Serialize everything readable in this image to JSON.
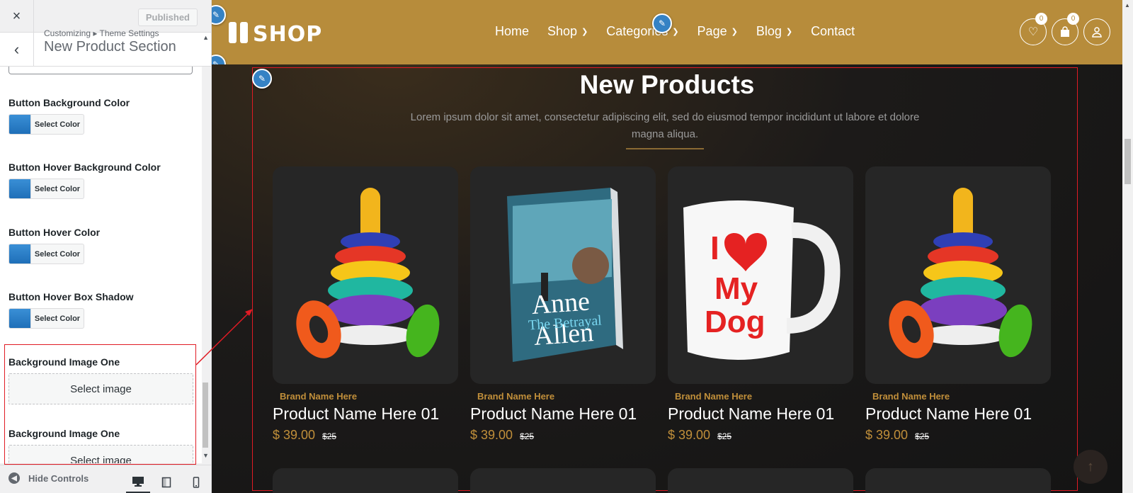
{
  "customizer": {
    "close_icon": "×",
    "publish_label": "Published",
    "breadcrumb": "Customizing ▸ Theme Settings",
    "section_title": "New Product Section",
    "controls": [
      {
        "label": "Button Background Color",
        "button": "Select Color"
      },
      {
        "label": "Button Hover Background Color",
        "button": "Select Color"
      },
      {
        "label": "Button Hover Color",
        "button": "Select Color"
      },
      {
        "label": "Button Hover Box Shadow",
        "button": "Select Color"
      }
    ],
    "image_controls": [
      {
        "label": "Background Image One",
        "button": "Select image"
      },
      {
        "label": "Background Image One",
        "button": "Select image"
      }
    ],
    "hide_controls": "Hide Controls",
    "swatch_color": "#2b7fcb"
  },
  "site": {
    "logo_text": "SHOP",
    "nav": [
      {
        "label": "Home",
        "dropdown": false
      },
      {
        "label": "Shop",
        "dropdown": true
      },
      {
        "label": "Categories",
        "dropdown": true
      },
      {
        "label": "Page",
        "dropdown": true
      },
      {
        "label": "Blog",
        "dropdown": true
      },
      {
        "label": "Contact",
        "dropdown": false
      }
    ],
    "wishlist_count": "0",
    "cart_count": "0",
    "header_color": "#b78c3b",
    "accent_color": "#c18f3a"
  },
  "section": {
    "title": "New Products",
    "description": "Lorem ipsum dolor sit amet, consectetur adipiscing elit, sed do eiusmod tempor incididunt ut labore et dolore magna aliqua.",
    "products": [
      {
        "brand": "Brand Name Here",
        "name": "Product Name Here 01",
        "price": "$ 39.00",
        "old_price": "$25",
        "image": "stacking-rings-toy"
      },
      {
        "brand": "Brand Name Here",
        "name": "Product Name Here 01",
        "price": "$ 39.00",
        "old_price": "$25",
        "image": "book-anne-allen-the-betrayal",
        "book_author": "Anne Allen",
        "book_title": "The Betrayal"
      },
      {
        "brand": "Brand Name Here",
        "name": "Product Name Here 01",
        "price": "$ 39.00",
        "old_price": "$25",
        "image": "i-love-my-dog-mug",
        "mug_text_1": "I",
        "mug_text_2": "My",
        "mug_text_3": "Dog"
      },
      {
        "brand": "Brand Name Here",
        "name": "Product Name Here 01",
        "price": "$ 39.00",
        "old_price": "$25",
        "image": "stacking-rings-toy"
      }
    ]
  }
}
